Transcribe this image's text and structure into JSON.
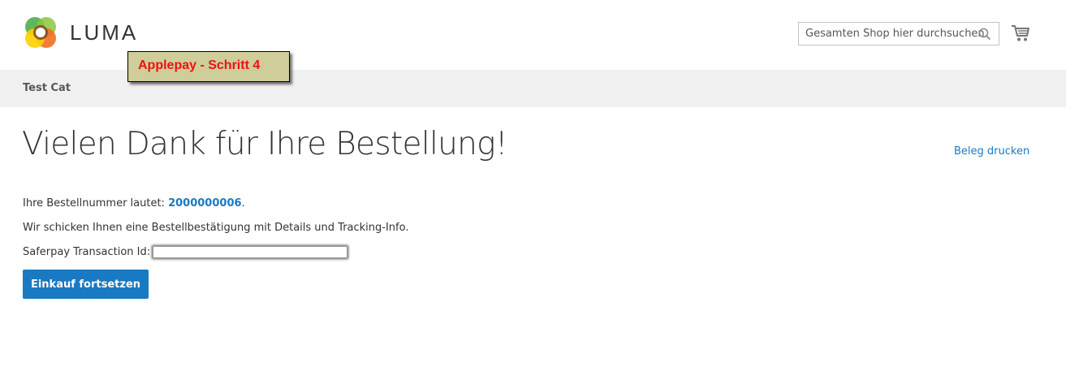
{
  "logo": {
    "text": "LUMA"
  },
  "search": {
    "placeholder": "Gesamten Shop hier durchsuchen..."
  },
  "icons": {
    "search": "search-icon",
    "cart": "cart-icon",
    "logo": "luma-logo-icon"
  },
  "annotation": {
    "text": "Applepay - Schritt 4"
  },
  "nav": {
    "items": [
      {
        "label": "Test Cat"
      }
    ]
  },
  "main": {
    "title": "Vielen Dank für Ihre Bestellung!",
    "print_label": "Beleg drucken",
    "order_prefix": "Ihre Bestellnummer lautet: ",
    "order_number": "2000000006",
    "order_suffix": ".",
    "confirmation_text": "Wir schicken Ihnen eine Bestellbestätigung mit Details und Tracking-Info.",
    "transaction_label": "Saferpay Transaction Id:",
    "continue_label": "Einkauf fortsetzen"
  },
  "colors": {
    "link": "#1979c3",
    "button": "#1979c3",
    "navbar": "#f0f0f0",
    "annotation_bg": "#cfcd99",
    "annotation_text": "#ee1111"
  }
}
